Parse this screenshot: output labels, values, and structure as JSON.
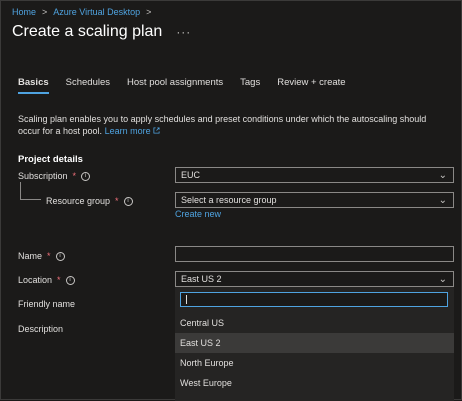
{
  "breadcrumb": {
    "home": "Home",
    "parent": "Azure Virtual Desktop",
    "sep": ">"
  },
  "page": {
    "title": "Create a scaling plan",
    "more": "···"
  },
  "tabs": [
    {
      "label": "Basics",
      "active": true
    },
    {
      "label": "Schedules"
    },
    {
      "label": "Host pool assignments"
    },
    {
      "label": "Tags"
    },
    {
      "label": "Review + create"
    }
  ],
  "intro": {
    "text": "Scaling plan enables you to apply schedules and preset conditions under which the autoscaling should occur for a host pool.",
    "learn_more": "Learn more"
  },
  "project_details": {
    "heading": "Project details",
    "subscription": {
      "label": "Subscription",
      "value": "EUC"
    },
    "resource_group": {
      "label": "Resource group",
      "placeholder": "Select a resource group",
      "create_new": "Create new"
    }
  },
  "form": {
    "name": {
      "label": "Name",
      "value": ""
    },
    "location": {
      "label": "Location",
      "value": "East US 2"
    },
    "friendly_name": {
      "label": "Friendly name"
    },
    "description": {
      "label": "Description"
    }
  },
  "location_dropdown": {
    "search_value": "",
    "options": [
      {
        "label": "Central US"
      },
      {
        "label": "East US 2",
        "selected": true
      },
      {
        "label": "North Europe"
      },
      {
        "label": "West Europe"
      }
    ]
  },
  "icons": {
    "info": "info-icon",
    "chevron": "chevron-down-icon",
    "external": "external-link-icon"
  },
  "colors": {
    "accent": "#4fa3e0",
    "background": "#1b1a19",
    "required": "#f1707b"
  }
}
